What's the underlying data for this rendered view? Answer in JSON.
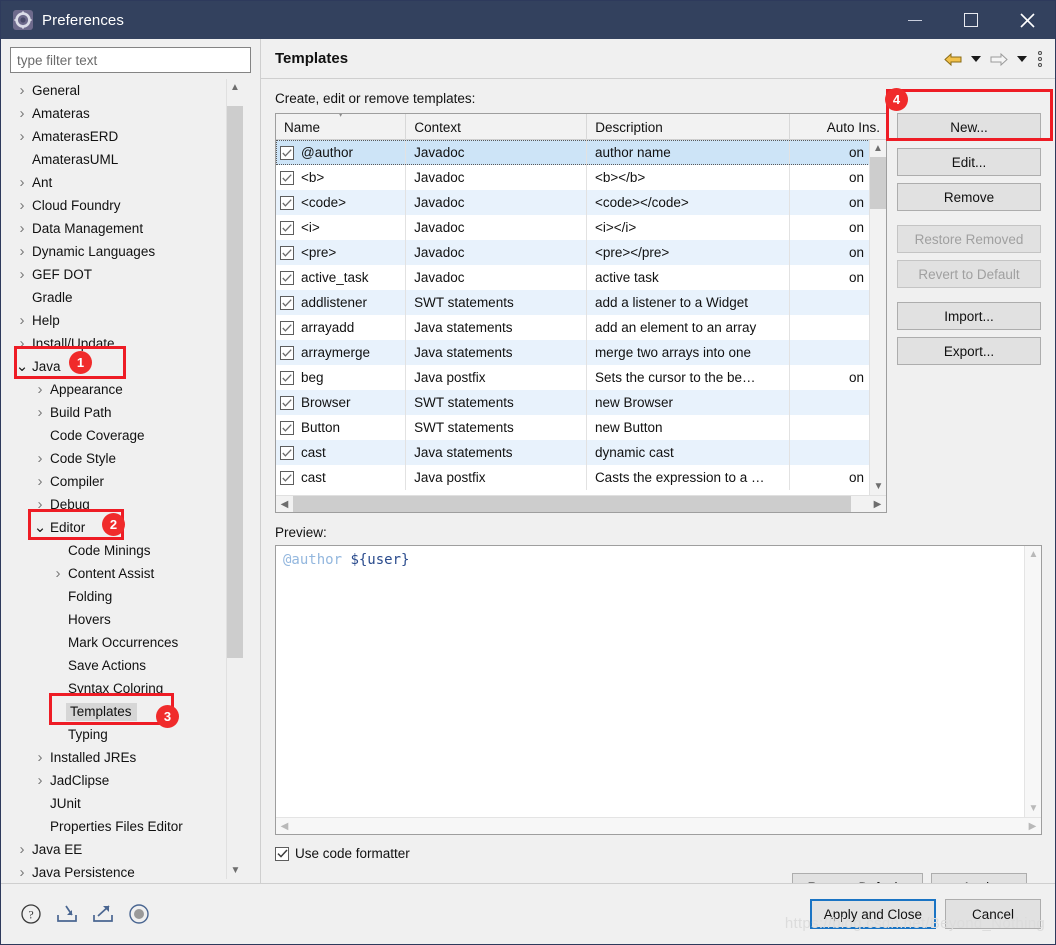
{
  "window": {
    "title": "Preferences",
    "icon": "eclipse-gear-icon",
    "minimize_label": "Minimize",
    "maximize_label": "Maximize",
    "close_label": "Close"
  },
  "filter": {
    "placeholder": "type filter text",
    "value": ""
  },
  "tree": {
    "items": [
      {
        "label": "General",
        "indent": 0,
        "state": "collapsed"
      },
      {
        "label": "Amateras",
        "indent": 0,
        "state": "collapsed"
      },
      {
        "label": "AmaterasERD",
        "indent": 0,
        "state": "collapsed"
      },
      {
        "label": "AmaterasUML",
        "indent": 0,
        "state": "leaf"
      },
      {
        "label": "Ant",
        "indent": 0,
        "state": "collapsed"
      },
      {
        "label": "Cloud Foundry",
        "indent": 0,
        "state": "collapsed"
      },
      {
        "label": "Data Management",
        "indent": 0,
        "state": "collapsed"
      },
      {
        "label": "Dynamic Languages",
        "indent": 0,
        "state": "collapsed"
      },
      {
        "label": "GEF DOT",
        "indent": 0,
        "state": "collapsed"
      },
      {
        "label": "Gradle",
        "indent": 0,
        "state": "leaf"
      },
      {
        "label": "Help",
        "indent": 0,
        "state": "collapsed"
      },
      {
        "label": "Install/Update",
        "indent": 0,
        "state": "collapsed"
      },
      {
        "label": "Java",
        "indent": 0,
        "state": "expanded"
      },
      {
        "label": "Appearance",
        "indent": 1,
        "state": "collapsed"
      },
      {
        "label": "Build Path",
        "indent": 1,
        "state": "collapsed"
      },
      {
        "label": "Code Coverage",
        "indent": 1,
        "state": "leaf"
      },
      {
        "label": "Code Style",
        "indent": 1,
        "state": "collapsed"
      },
      {
        "label": "Compiler",
        "indent": 1,
        "state": "collapsed"
      },
      {
        "label": "Debug",
        "indent": 1,
        "state": "collapsed"
      },
      {
        "label": "Editor",
        "indent": 1,
        "state": "expanded"
      },
      {
        "label": "Code Minings",
        "indent": 2,
        "state": "leaf"
      },
      {
        "label": "Content Assist",
        "indent": 2,
        "state": "collapsed"
      },
      {
        "label": "Folding",
        "indent": 2,
        "state": "leaf"
      },
      {
        "label": "Hovers",
        "indent": 2,
        "state": "leaf"
      },
      {
        "label": "Mark Occurrences",
        "indent": 2,
        "state": "leaf"
      },
      {
        "label": "Save Actions",
        "indent": 2,
        "state": "leaf"
      },
      {
        "label": "Syntax Coloring",
        "indent": 2,
        "state": "leaf"
      },
      {
        "label": "Templates",
        "indent": 2,
        "state": "leaf",
        "selected": true
      },
      {
        "label": "Typing",
        "indent": 2,
        "state": "leaf"
      },
      {
        "label": "Installed JREs",
        "indent": 1,
        "state": "collapsed"
      },
      {
        "label": "JadClipse",
        "indent": 1,
        "state": "collapsed"
      },
      {
        "label": "JUnit",
        "indent": 1,
        "state": "leaf"
      },
      {
        "label": "Properties Files Editor",
        "indent": 1,
        "state": "leaf"
      },
      {
        "label": "Java EE",
        "indent": 0,
        "state": "collapsed"
      },
      {
        "label": "Java Persistence",
        "indent": 0,
        "state": "collapsed"
      }
    ]
  },
  "page": {
    "title": "Templates",
    "description": "Create, edit or remove templates:",
    "nav": {
      "back": "back-arrow-icon",
      "back_menu": "back-dropdown-icon",
      "forward": "forward-arrow-icon",
      "forward_menu": "forward-dropdown-icon",
      "menu": "view-menu-icon"
    }
  },
  "table": {
    "columns": [
      "Name",
      "Context",
      "Description",
      "Auto Ins."
    ],
    "sorted_column": "Name",
    "rows": [
      {
        "checked": true,
        "name": "@author",
        "context": "Javadoc",
        "description": "author name",
        "auto": "on",
        "selected": true
      },
      {
        "checked": true,
        "name": "<b>",
        "context": "Javadoc",
        "description": "<b></b>",
        "auto": "on"
      },
      {
        "checked": true,
        "name": "<code>",
        "context": "Javadoc",
        "description": "<code></code>",
        "auto": "on"
      },
      {
        "checked": true,
        "name": "<i>",
        "context": "Javadoc",
        "description": "<i></i>",
        "auto": "on"
      },
      {
        "checked": true,
        "name": "<pre>",
        "context": "Javadoc",
        "description": "<pre></pre>",
        "auto": "on"
      },
      {
        "checked": true,
        "name": "active_task",
        "context": "Javadoc",
        "description": "active task",
        "auto": "on"
      },
      {
        "checked": true,
        "name": "addlistener",
        "context": "SWT statements",
        "description": "add a listener to a Widget",
        "auto": ""
      },
      {
        "checked": true,
        "name": "arrayadd",
        "context": "Java statements",
        "description": "add an element to an array",
        "auto": ""
      },
      {
        "checked": true,
        "name": "arraymerge",
        "context": "Java statements",
        "description": "merge two arrays into one",
        "auto": ""
      },
      {
        "checked": true,
        "name": "beg",
        "context": "Java postfix",
        "description": "Sets the cursor to the be…",
        "auto": "on"
      },
      {
        "checked": true,
        "name": "Browser",
        "context": "SWT statements",
        "description": "new Browser",
        "auto": ""
      },
      {
        "checked": true,
        "name": "Button",
        "context": "SWT statements",
        "description": "new Button",
        "auto": ""
      },
      {
        "checked": true,
        "name": "cast",
        "context": "Java statements",
        "description": "dynamic cast",
        "auto": ""
      },
      {
        "checked": true,
        "name": "cast",
        "context": "Java postfix",
        "description": "Casts the expression to a …",
        "auto": "on"
      }
    ]
  },
  "side_buttons": [
    {
      "label": "New...",
      "enabled": true,
      "name": "new-template-button"
    },
    {
      "label": "Edit...",
      "enabled": true,
      "name": "edit-template-button"
    },
    {
      "label": "Remove",
      "enabled": true,
      "name": "remove-template-button"
    },
    {
      "label": "Restore Removed",
      "enabled": false,
      "name": "restore-removed-button"
    },
    {
      "label": "Revert to Default",
      "enabled": false,
      "name": "revert-to-default-button"
    },
    {
      "label": "Import...",
      "enabled": true,
      "name": "import-templates-button"
    },
    {
      "label": "Export...",
      "enabled": true,
      "name": "export-templates-button"
    }
  ],
  "preview": {
    "label": "Preview:",
    "code_tag": "@author",
    "code_var": "${user}"
  },
  "formatter": {
    "label": "Use code formatter",
    "checked": true
  },
  "page_buttons": {
    "restore_defaults": "Restore Defaults",
    "apply": "Apply"
  },
  "dialog_buttons": {
    "apply_and_close": "Apply and Close",
    "cancel": "Cancel"
  },
  "bottom_icons": [
    {
      "name": "help-icon"
    },
    {
      "name": "import-preferences-icon"
    },
    {
      "name": "export-preferences-icon"
    },
    {
      "name": "status-circle-icon"
    }
  ],
  "annotations": [
    {
      "id": "1",
      "target": "Java"
    },
    {
      "id": "2",
      "target": "Editor"
    },
    {
      "id": "3",
      "target": "Templates"
    },
    {
      "id": "4",
      "target": "New..."
    }
  ],
  "watermark": "https://blog.csdn.net/Beyond_Nothing",
  "colors": {
    "titlebar": "#33415e",
    "accent": "#1a74c4",
    "annotation": "#ee1c25",
    "selected_row": "#cde4f7",
    "alt_row": "#e8f2fc"
  }
}
